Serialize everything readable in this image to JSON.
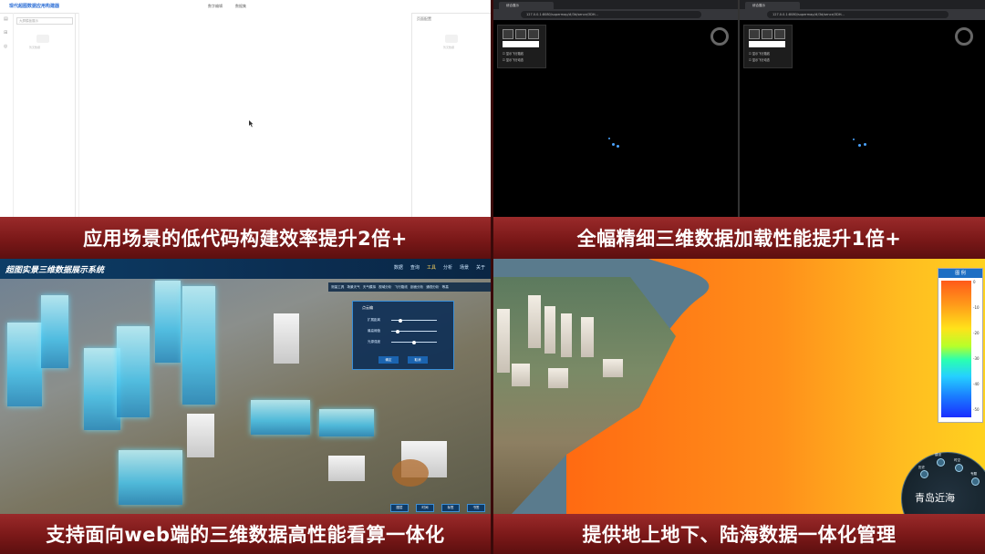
{
  "banners": {
    "top_left": "应用场景的低代码构建效率提升2倍+",
    "top_right": "全幅精细三维数据加载性能提升1倍+",
    "bottom_left": "支持面向web端的三维数据高性能看算一体化",
    "bottom_right": "提供地上地下、陆海数据一体化管理"
  },
  "lowcode": {
    "app_title": "现代超图数据应用构建器",
    "tabs": [
      "数字编辑",
      "数据集"
    ],
    "search_placeholder": "大屏模板展示",
    "left_empty": "暂无数据",
    "right_title": "页面配置",
    "right_empty": "暂无数据"
  },
  "browsers": {
    "left": {
      "tab": "综合展示",
      "url": "127.0.0.1:8080/supermap/#/3d/sence/3DH..."
    },
    "right": {
      "tab": "综合展示",
      "url": "127.0.0.1:8080/supermap/#/3d/sence/3DH..."
    },
    "checkbox1": "显示飞行路线",
    "checkbox2": "显示飞行动态"
  },
  "city3d": {
    "title": "超图实景三维数据展示系统",
    "nav": [
      "数据",
      "查询",
      "工具",
      "分析",
      "场景",
      "关于"
    ],
    "toolbar": [
      "测量工具",
      "场景天气",
      "天气模拟",
      "视域分析",
      "飞行路线",
      "剖面分析",
      "通视分析",
      "等高",
      "通视"
    ],
    "panel_title": "点云编",
    "panel_rows": [
      "扩展距离",
      "最高阈值",
      "光源强度"
    ],
    "panel_buttons": [
      "确定",
      "取消"
    ],
    "panel_levels": [
      0.15,
      0.1,
      0.45
    ],
    "bottom_buttons": [
      "图层",
      "时间",
      "标签",
      "书签"
    ]
  },
  "terrain": {
    "legend_title": "图 例",
    "legend_ticks": [
      "0",
      "-10",
      "-20",
      "-30",
      "-40",
      "-50"
    ],
    "place_name": "青岛近海",
    "dial_labels": [
      "建设",
      "历史",
      "时空",
      "规划",
      "专题",
      "导航"
    ]
  }
}
